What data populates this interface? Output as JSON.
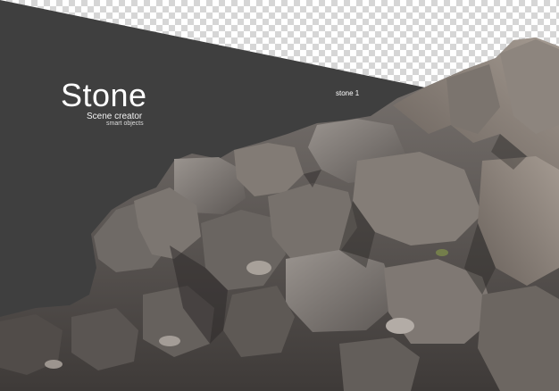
{
  "title": "Stone",
  "subtitle": "Scene creator",
  "subtitle_small": "smart objects",
  "item_label": "stone 1",
  "colors": {
    "backdrop": "#3f3f3f",
    "checker_light": "#ffffff",
    "checker_dark": "#d6d6d6",
    "rock_light": "#8e8883",
    "rock_mid": "#6f6a66",
    "rock_dark": "#4a4644",
    "rock_shadow": "#2d2a29"
  }
}
